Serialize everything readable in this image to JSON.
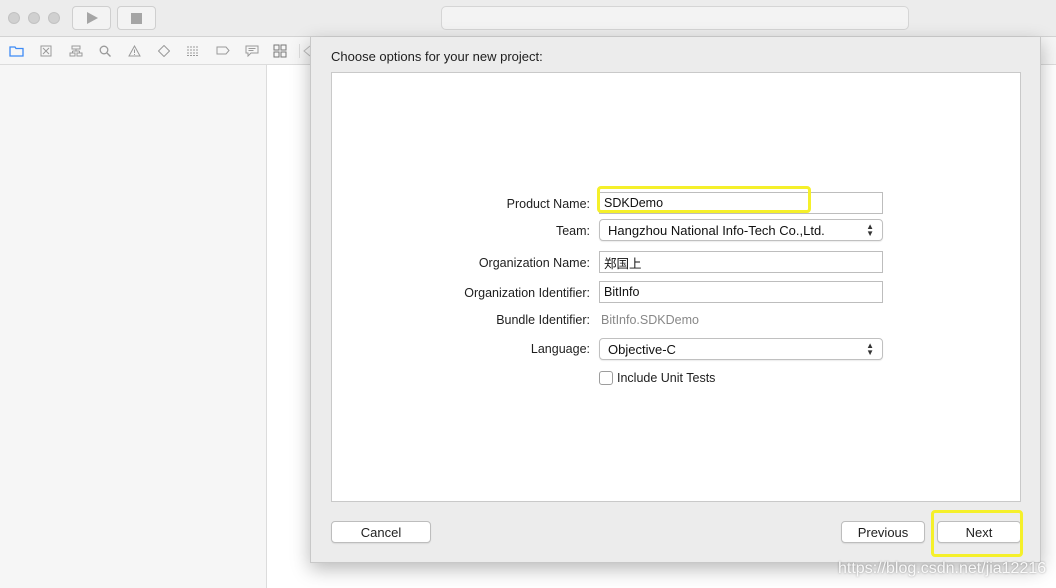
{
  "sheet": {
    "title": "Choose options for your new project:"
  },
  "form": {
    "product_name": {
      "label": "Product Name:",
      "value": "SDKDemo"
    },
    "team": {
      "label": "Team:",
      "value": "Hangzhou National Info-Tech Co.,Ltd."
    },
    "org_name": {
      "label": "Organization Name:",
      "value": "郑国上"
    },
    "org_id": {
      "label": "Organization Identifier:",
      "value": "BitInfo"
    },
    "bundle_id": {
      "label": "Bundle Identifier:",
      "value": "BitInfo.SDKDemo"
    },
    "language": {
      "label": "Language:",
      "value": "Objective-C"
    },
    "unit_tests": {
      "label": "Include Unit Tests",
      "checked": false
    }
  },
  "buttons": {
    "cancel": "Cancel",
    "previous": "Previous",
    "next": "Next"
  },
  "navigator_icons": [
    "folder-icon",
    "source-control-icon",
    "hierarchy-icon",
    "search-icon",
    "warning-icon",
    "test-icon",
    "debug-icon",
    "breakpoint-icon",
    "report-icon"
  ],
  "watermark": "https://blog.csdn.net/jia12216",
  "colors": {
    "highlight": "#f5f02a",
    "accent": "#3d8bf6"
  }
}
